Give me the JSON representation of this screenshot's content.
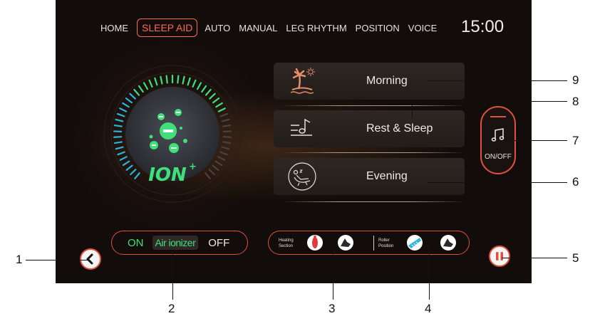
{
  "nav": {
    "items": [
      "HOME",
      "SLEEP AID",
      "AUTO",
      "MANUAL",
      "LEG RHYTHM",
      "POSITION",
      "VOICE"
    ],
    "active": "SLEEP AID"
  },
  "clock": "15:00",
  "ionizer": {
    "logo": "ION",
    "on_label": "ON",
    "label": "Air ionizer",
    "off_label": "OFF"
  },
  "presets": [
    {
      "label": "Morning",
      "icon": "palm-tree-sun-icon"
    },
    {
      "label": "Rest & Sleep",
      "icon": "music-note-lines-icon"
    },
    {
      "label": "Evening",
      "icon": "reclining-chair-icon"
    }
  ],
  "music": {
    "label": "ON/OFF",
    "icon": "music-note-icon"
  },
  "heating": {
    "label_line1": "Heating",
    "label_line2": "Section"
  },
  "roller": {
    "label_line1": "Roller",
    "label_line2": "Position"
  },
  "callouts": [
    "1",
    "2",
    "3",
    "4",
    "5",
    "6",
    "7",
    "8",
    "9"
  ],
  "colors": {
    "accent": "#e2513a",
    "green": "#3fe07a",
    "cyan": "#2ab6d8",
    "background": "#120c0a"
  }
}
